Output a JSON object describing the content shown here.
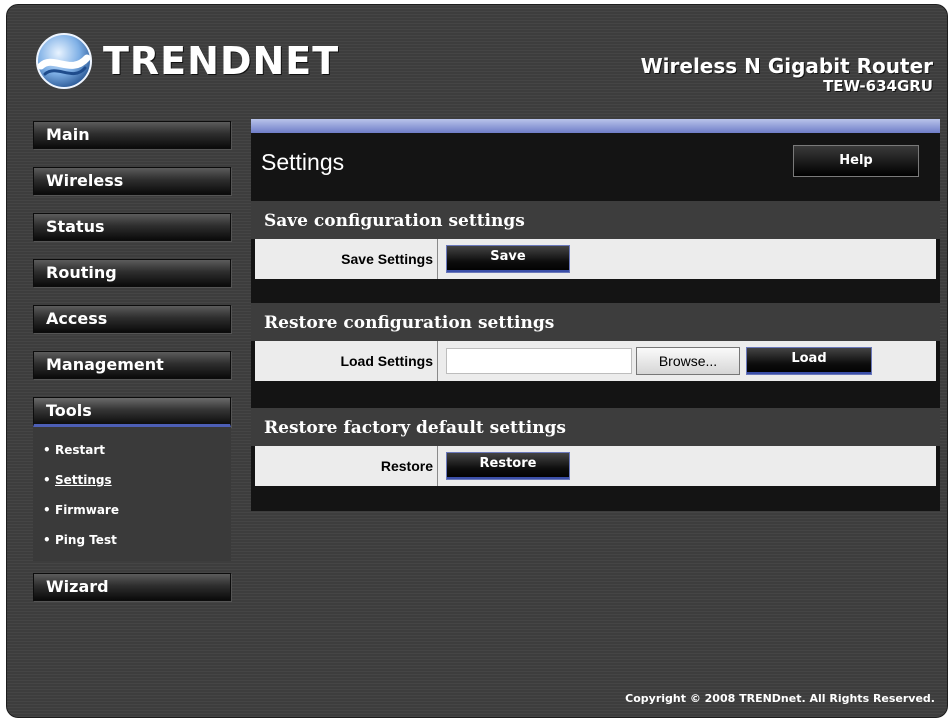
{
  "brand": {
    "logo_text": "TRENDNET",
    "product_name": "Wireless N Gigabit Router",
    "model": "TEW-634GRU"
  },
  "nav": {
    "items": [
      {
        "label": "Main"
      },
      {
        "label": "Wireless"
      },
      {
        "label": "Status"
      },
      {
        "label": "Routing"
      },
      {
        "label": "Access"
      },
      {
        "label": "Management"
      },
      {
        "label": "Tools"
      },
      {
        "label": "Wizard"
      }
    ],
    "tools_sub": [
      {
        "label": "Restart"
      },
      {
        "label": "Settings"
      },
      {
        "label": "Firmware"
      },
      {
        "label": "Ping Test"
      }
    ]
  },
  "page": {
    "title": "Settings",
    "help_label": "Help",
    "save_section": {
      "heading": "Save configuration settings",
      "row_label": "Save Settings",
      "button_label": "Save"
    },
    "restore_section": {
      "heading": "Restore configuration settings",
      "row_label": "Load Settings",
      "file_value": "",
      "browse_label": "Browse...",
      "button_label": "Load"
    },
    "factory_section": {
      "heading": "Restore factory default settings",
      "row_label": "Restore",
      "button_label": "Restore"
    }
  },
  "footer": {
    "copyright": "Copyright © 2008 TRENDnet. All Rights Reserved."
  },
  "colors": {
    "accent_blue": "#4d5fb6",
    "panel_bar": "#8c9ad6",
    "background": "#3d3d3d"
  }
}
